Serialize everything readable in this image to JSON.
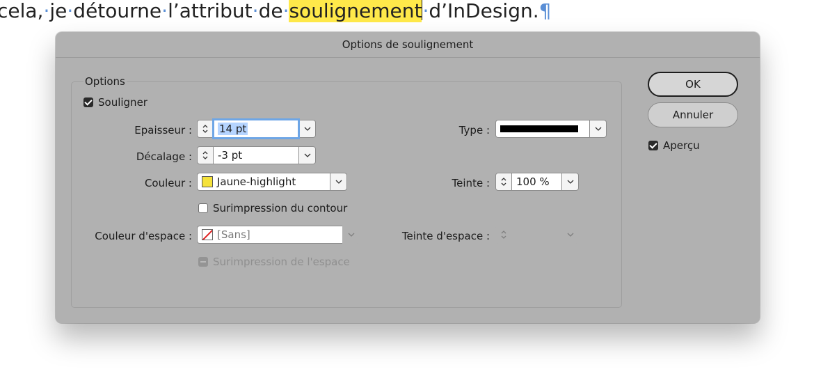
{
  "document": {
    "words": [
      "cela,",
      "je",
      "détourne",
      "l’attribut",
      "de"
    ],
    "highlighted_word": "soulignement",
    "after_caret": "d’InDesign.",
    "pilcrow": "¶",
    "highlight_color": "#ffe94a"
  },
  "dialog": {
    "title": "Options de soulignement",
    "group_title": "Options",
    "underline_checkbox": {
      "label": "Souligner",
      "checked": true
    },
    "thickness": {
      "label": "Epaisseur :",
      "value": "14 pt"
    },
    "offset": {
      "label": "Décalage :",
      "value": "-3 pt"
    },
    "color": {
      "label": "Couleur :",
      "value": "Jaune-highlight",
      "swatch": "#f5e23a"
    },
    "overprint_stroke": {
      "label": "Surimpression du contour",
      "checked": false
    },
    "gap_color": {
      "label": "Couleur d'espace :",
      "value": "[Sans]"
    },
    "overprint_gap": {
      "label": "Surimpression de l'espace",
      "checked": false,
      "disabled": true
    },
    "type": {
      "label": "Type :"
    },
    "tint": {
      "label": "Teinte :",
      "value": "100 %"
    },
    "gap_tint": {
      "label": "Teinte d'espace :",
      "value": ""
    },
    "ok_label": "OK",
    "cancel_label": "Annuler",
    "preview_checkbox": {
      "label": "Aperçu",
      "checked": true
    }
  }
}
